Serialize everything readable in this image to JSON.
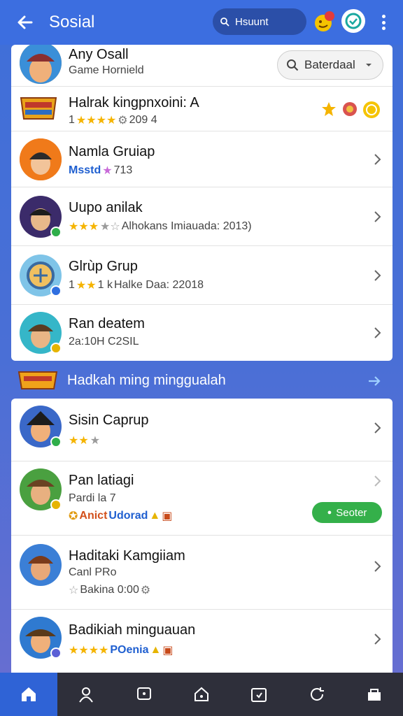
{
  "header": {
    "title": "Sosial",
    "search_label": "Hsuunt",
    "notification_count": "1"
  },
  "top_card": {
    "partial_item": {
      "title": "Any Osall",
      "subtitle": "Game Hornield"
    },
    "sort_label": "Baterdaal",
    "rows": [
      {
        "title": "Halrak kingpnxoini: A",
        "rating": "1",
        "stat": "209 4",
        "badge_color": "#ffffff"
      },
      {
        "title": "Namla Gruiap",
        "sub_blue": "Msstd",
        "stat": "713",
        "badge_color": "#ffffff"
      },
      {
        "title": "Uupo anilak",
        "stat": "Alhokans Imiauada: 2013)",
        "badge_color": "#2fae4a"
      },
      {
        "title": "Glrùp Grup",
        "rating": "1",
        "stat": "Halke Daa: 22018",
        "badge_color": "#2f6fe0"
      },
      {
        "title": "Ran deatem",
        "stat": "2a:10H C2SIL",
        "badge_color": "#e6b400"
      }
    ]
  },
  "section": {
    "title": "Hadkah ming minggualah"
  },
  "bottom_card": {
    "rows": [
      {
        "title": "Sisin Caprup",
        "badge_color": "#2fae4a"
      },
      {
        "title": "Pan latiagi",
        "subtitle": "Pardi la 7",
        "tag1": "Anict",
        "tag2": "Udorad",
        "action": "Seoter",
        "badge_color": "#e6b400"
      },
      {
        "title": "Haditaki Kamgiiam",
        "subtitle": "Canl PRo",
        "stat": "Bakina 0:00",
        "badge_color": "#e6b400"
      },
      {
        "title": "Badikiah minguauan",
        "tag_blue": "POenia",
        "badge_color": "#5a5fd6"
      }
    ]
  },
  "colors": {
    "header": "#3c6ee0",
    "accent_green": "#34b04a",
    "star": "#f5b400",
    "nav_active": "#2f63d6"
  },
  "nav": [
    "home-icon",
    "profile-icon",
    "chat-icon",
    "house-icon",
    "calendar-icon",
    "refresh-icon",
    "store-icon"
  ]
}
